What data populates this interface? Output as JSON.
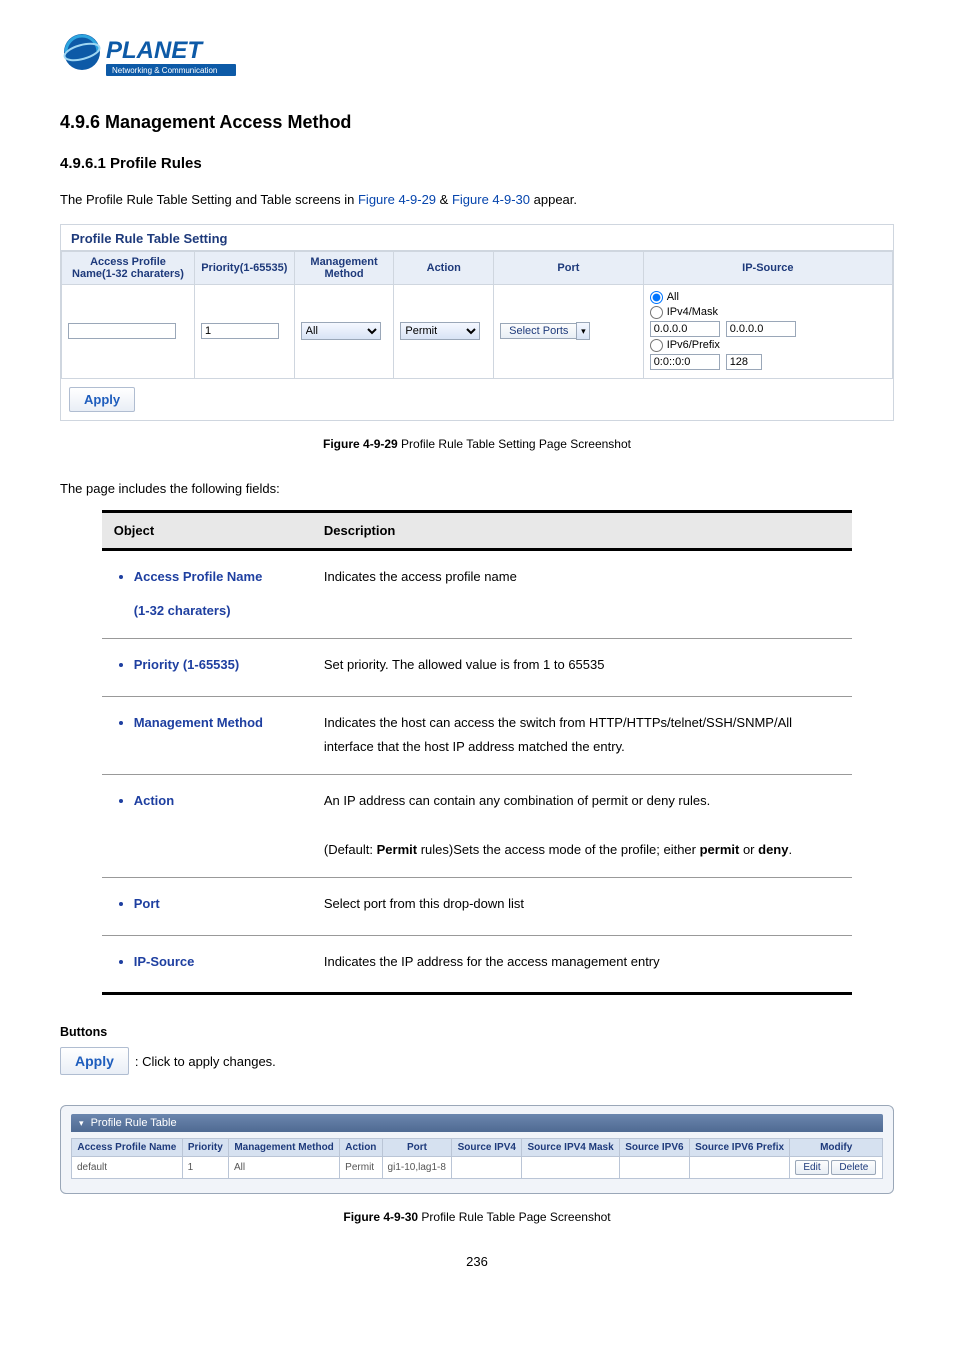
{
  "logo": {
    "brand": "PLANET",
    "tagline": "Networking & Communication"
  },
  "section_title": "4.9.6 Management Access Method",
  "subsection_title": "4.9.6.1 Profile Rules",
  "intro_prefix": "The Profile Rule Table Setting and Table screens in ",
  "intro_midfix": " & ",
  "intro_suffix": " appear.",
  "figlink1": "Figure 4-9-29",
  "figlink2": "Figure 4-9-30",
  "panel1": {
    "title": "Profile Rule Table Setting",
    "headers": {
      "name": "Access Profile Name(1-32 charaters)",
      "priority": "Priority(1-65535)",
      "method": "Management Method",
      "action": "Action",
      "port": "Port",
      "ipsource": "IP-Source"
    },
    "row": {
      "name_value": "",
      "priority_value": "1",
      "method_value": "All",
      "action_value": "Permit",
      "select_ports_label": "Select Ports",
      "ip_all_label": "All",
      "ip_v4mask_label": "IPv4/Mask",
      "ip_v4_a": "0.0.0.0",
      "ip_v4_b": "0.0.0.0",
      "ip_v6prefix_label": "IPv6/Prefix",
      "ip_v6_a": "0:0::0:0",
      "ip_v6_b": "128"
    },
    "apply_label": "Apply"
  },
  "fig1_bold": "Figure 4-9-29",
  "fig1_rest": " Profile Rule Table Setting Page Screenshot",
  "fields_line": "The page includes the following fields:",
  "desc_table": {
    "head_object": "Object",
    "head_desc": "Description",
    "rows": [
      {
        "object_lines": [
          "Access Profile Name",
          "(1-32 charaters)"
        ],
        "desc": "Indicates the access profile name"
      },
      {
        "object_lines": [
          "Priority (1-65535)"
        ],
        "desc": "Set priority. The allowed value is from 1 to 65535"
      },
      {
        "object_lines": [
          "Management Method"
        ],
        "desc": "Indicates the host can access the switch from HTTP/HTTPs/telnet/SSH/SNMP/All interface that the host IP address matched the entry."
      },
      {
        "object_lines": [
          "Action"
        ],
        "desc_html": "An IP address can contain any combination of permit or deny rules.<br><br>(Default: <b>Permit</b> rules)Sets the access mode of the profile; either <b>permit</b> or <b>deny</b>."
      },
      {
        "object_lines": [
          "Port"
        ],
        "desc": "Select port from this drop-down list"
      },
      {
        "object_lines": [
          "IP-Source"
        ],
        "desc": "Indicates the IP address for the access management entry"
      }
    ]
  },
  "buttons_heading": "Buttons",
  "apply_big_label": "Apply",
  "apply_big_text": ": Click to apply changes.",
  "panel2": {
    "title": "Profile Rule Table",
    "headers": [
      "Access Profile Name",
      "Priority",
      "Management Method",
      "Action",
      "Port",
      "Source IPV4",
      "Source IPV4 Mask",
      "Source IPV6",
      "Source IPV6 Prefix",
      "Modify"
    ],
    "row": {
      "name": "default",
      "priority": "1",
      "method": "All",
      "action": "Permit",
      "port": "gi1-10,lag1-8",
      "sipv4": "",
      "sipv4m": "",
      "sipv6": "",
      "sipv6p": "",
      "edit_label": "Edit",
      "delete_label": "Delete"
    }
  },
  "fig2_bold": "Figure 4-9-30",
  "fig2_rest": " Profile Rule Table Page Screenshot",
  "page_number": "236"
}
